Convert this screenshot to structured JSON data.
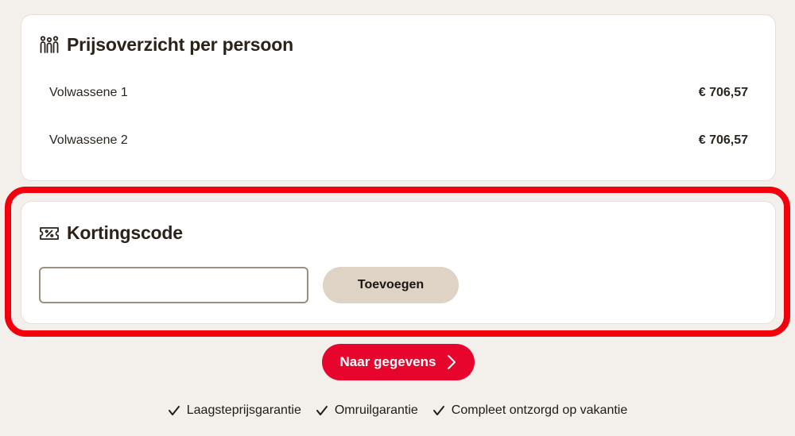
{
  "price_overview": {
    "title": "Prijsoverzicht per persoon",
    "icon": "family-icon",
    "rows": [
      {
        "label": "Volwassene 1",
        "amount": "€ 706,57"
      },
      {
        "label": "Volwassene 2",
        "amount": "€ 706,57"
      }
    ]
  },
  "discount": {
    "title": "Kortingscode",
    "icon": "discount-ticket-icon",
    "input_value": "",
    "add_label": "Toevoegen"
  },
  "next": {
    "label": "Naar gegevens",
    "icon": "chevron-right-icon"
  },
  "guarantees": [
    {
      "label": "Laagsteprijsgarantie",
      "icon": "checkmark-icon"
    },
    {
      "label": "Omruilgarantie",
      "icon": "checkmark-icon"
    },
    {
      "label": "Compleet ontzorgd op vakantie",
      "icon": "checkmark-icon"
    }
  ],
  "colors": {
    "page_background": "#f3efeb",
    "primary_button": "#e8052d",
    "secondary_button": "#ded3c4",
    "highlight_outline": "#f2000c",
    "heading_text": "#2b2219"
  }
}
